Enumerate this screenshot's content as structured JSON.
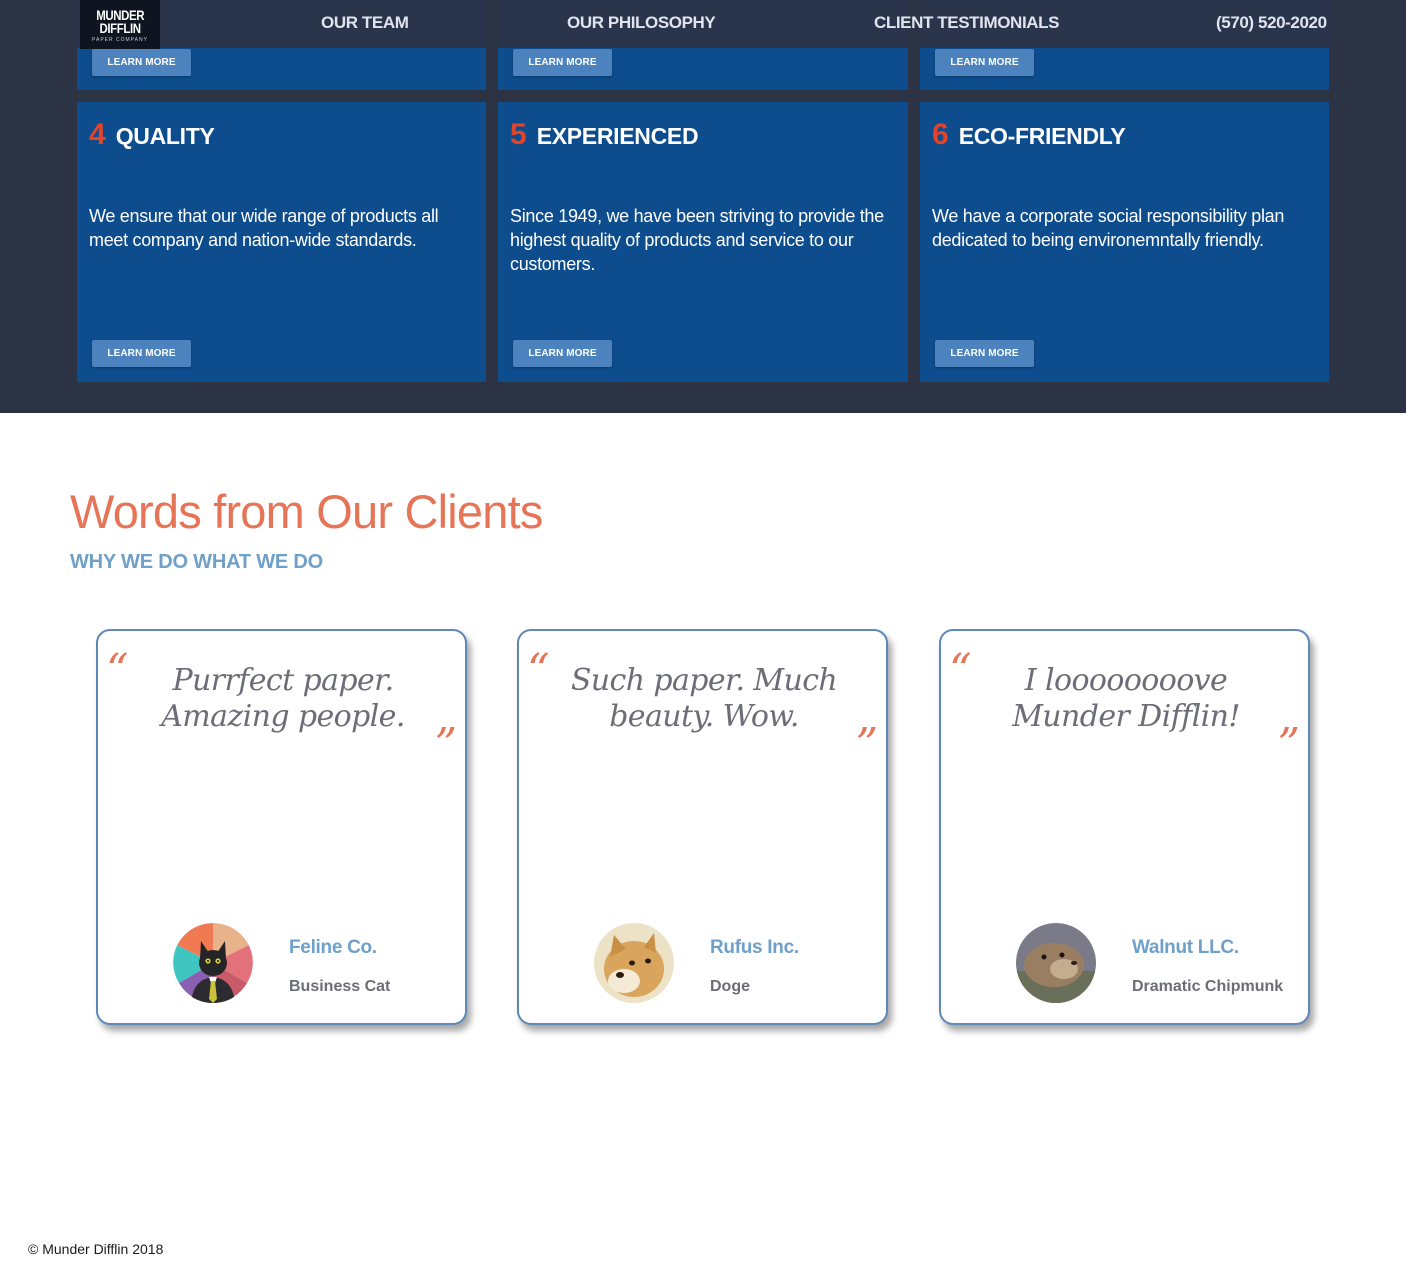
{
  "nav": {
    "logo_line1": "MUNDER",
    "logo_line2": "DIFFLIN",
    "logo_sub": "PAPER COMPANY",
    "team": "OUR TEAM",
    "philosophy": "OUR PHILOSOPHY",
    "testimonials": "CLIENT TESTIMONIALS",
    "phone": "(570) 520-2020"
  },
  "features_top": [
    {
      "button": "LEARN MORE"
    },
    {
      "button": "LEARN MORE"
    },
    {
      "button": "LEARN MORE"
    }
  ],
  "features": [
    {
      "number": "4",
      "title": "QUALITY",
      "text": "We ensure that our wide range of products all meet company and nation-wide standards.",
      "button": "LEARN MORE"
    },
    {
      "number": "5",
      "title": "EXPERIENCED",
      "text": "Since 1949, we have been striving to provide the highest quality of products and service to our customers.",
      "button": "LEARN MORE"
    },
    {
      "number": "6",
      "title": "ECO-FRIENDLY",
      "text": "We have a corporate social responsibility plan dedicated to being environemntally friendly.",
      "button": "LEARN MORE"
    }
  ],
  "clients_section": {
    "title": "Words from Our Clients",
    "subtitle": "WHY WE DO WHAT WE DO"
  },
  "testimonials": [
    {
      "quote_open": "“",
      "quote": "Purrfect paper. Amazing people.",
      "quote_close": "”",
      "name": "Feline Co.",
      "role": "Business Cat",
      "avatar_icon": "cat-avatar-icon"
    },
    {
      "quote_open": "“",
      "quote": "Such paper. Much beauty. Wow.",
      "quote_close": "”",
      "name": "Rufus Inc.",
      "role": "Doge",
      "avatar_icon": "dog-avatar-icon"
    },
    {
      "quote_open": "“",
      "quote": "I loooooooove Munder Difflin!",
      "quote_close": "”",
      "name": "Walnut LLC.",
      "role": "Dramatic Chipmunk",
      "avatar_icon": "chipmunk-avatar-icon"
    }
  ],
  "footer": {
    "copyright": "© Munder Difflin 2018"
  },
  "colors": {
    "dark_bg": "#2c3345",
    "card_blue": "#0d4c8d",
    "button_blue": "#4c82bd",
    "accent_orange": "#e67558",
    "number_red": "#e4432a",
    "heading_blue": "#6fa0c9",
    "quote_gray": "#6d6d78"
  }
}
